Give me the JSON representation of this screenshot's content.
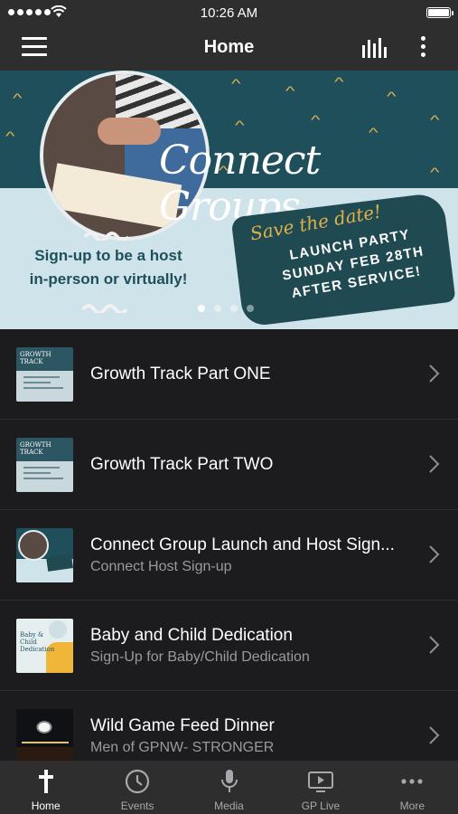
{
  "status_bar": {
    "time": "10:26 AM"
  },
  "header": {
    "title": "Home"
  },
  "banner": {
    "heading": "Connect Groups",
    "signup_text": "Sign-up to be a host in-person or virtually!",
    "save_the_date": "Save the date!",
    "launch_lines": [
      "LAUNCH PARTY",
      "SUNDAY FEB 28TH",
      "AFTER SERVICE!"
    ],
    "page_count": 4,
    "active_page": 1
  },
  "list": {
    "items": [
      {
        "title": "Growth Track Part ONE",
        "subtitle": "",
        "thumb": "growth-track-thumbnail",
        "thumb_text": "GROWTH TRACK"
      },
      {
        "title": "Growth Track Part TWO",
        "subtitle": "",
        "thumb": "growth-track-thumbnail",
        "thumb_text": "GROWTH TRACK"
      },
      {
        "title": "Connect Group Launch and Host Sign...",
        "subtitle": "Connect Host Sign-up",
        "thumb": "connect-groups-thumbnail"
      },
      {
        "title": "Baby and Child Dedication",
        "subtitle": "Sign-Up for Baby/Child Dedication",
        "thumb": "baby-dedication-thumbnail",
        "thumb_text": "Baby & Child Dedication"
      },
      {
        "title": "Wild Game Feed Dinner",
        "subtitle": "Men of GPNW- STRONGER",
        "thumb": "wild-game-thumbnail"
      }
    ]
  },
  "tab_bar": {
    "tabs": [
      {
        "label": "Home",
        "icon": "cross-icon",
        "active": true
      },
      {
        "label": "Events",
        "icon": "clock-icon",
        "active": false
      },
      {
        "label": "Media",
        "icon": "microphone-icon",
        "active": false
      },
      {
        "label": "GP Live",
        "icon": "tv-play-icon",
        "active": false
      },
      {
        "label": "More",
        "icon": "more-dots-icon",
        "active": false
      }
    ]
  },
  "colors": {
    "background": "#1c1c1e",
    "bar": "#2e2e2e",
    "banner_teal": "#1f4f5a",
    "banner_light": "#cfe4ea",
    "accent_gold": "#e0b04a",
    "secondary_text": "#9a9a9e"
  }
}
